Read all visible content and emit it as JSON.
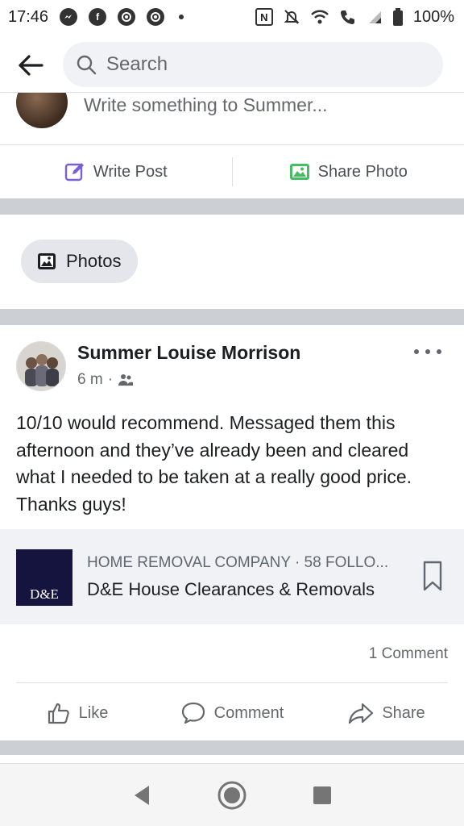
{
  "status_bar": {
    "time": "17:46",
    "notifications": [
      "messenger-icon",
      "facebook-icon",
      "chrome-icon",
      "chrome-icon"
    ],
    "battery_percent": "100%"
  },
  "header": {
    "search_placeholder": "Search"
  },
  "composer": {
    "placeholder": "Write something to Summer...",
    "write_post_label": "Write Post",
    "share_photo_label": "Share Photo"
  },
  "photos_chip": {
    "label": "Photos"
  },
  "post": {
    "author": "Summer Louise Morrison",
    "time": "6 m",
    "separator": "·",
    "audience_icon": "friends-icon",
    "text": "10/10 would recommend. Messaged them this afternoon and they’ve already been and cleared what I needed to be taken at a really good price. Thanks guys!",
    "link_card": {
      "logo_text": "D&E",
      "caption": "HOME REMOVAL COMPANY · 58 FOLLO...",
      "title": "D&E House Clearances & Removals"
    },
    "comment_count": "1 Comment",
    "actions": {
      "like": "Like",
      "comment": "Comment",
      "share": "Share"
    }
  },
  "colors": {
    "accent": "#1877f2",
    "photo_green": "#45bd62",
    "write_post_purple": "#7a5fd6",
    "separator": "#ccd0d5",
    "logo_navy": "#14143f"
  }
}
